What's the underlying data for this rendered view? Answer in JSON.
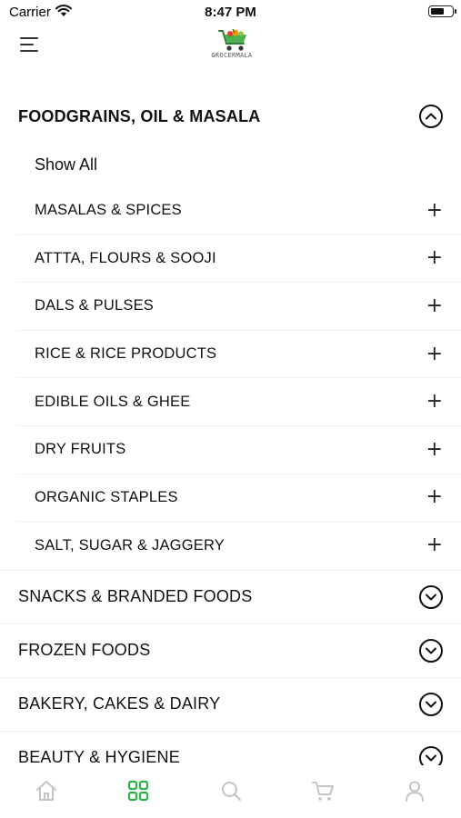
{
  "status_bar": {
    "carrier": "Carrier",
    "time": "8:47 PM"
  },
  "header": {
    "logo_text": "GROCERMALA"
  },
  "expanded_section": {
    "title": "FOODGRAINS, OIL & MASALA",
    "show_all": "Show All",
    "items": [
      {
        "label": "MASALAS & SPICES"
      },
      {
        "label": "ATTTA, FLOURS & SOOJI"
      },
      {
        "label": "DALS & PULSES"
      },
      {
        "label": "RICE & RICE PRODUCTS"
      },
      {
        "label": "EDIBLE OILS & GHEE"
      },
      {
        "label": "DRY FRUITS"
      },
      {
        "label": "ORGANIC STAPLES"
      },
      {
        "label": "SALT, SUGAR & JAGGERY"
      }
    ]
  },
  "categories": [
    {
      "label": "SNACKS & BRANDED FOODS"
    },
    {
      "label": "FROZEN FOODS"
    },
    {
      "label": "BAKERY, CAKES & DAIRY"
    },
    {
      "label": "BEAUTY & HYGIENE"
    }
  ],
  "bottom_nav": {
    "active": "categories",
    "active_color": "#2db34a",
    "inactive_color": "#c4c4c4",
    "items": [
      {
        "icon": "home-icon"
      },
      {
        "icon": "categories-icon"
      },
      {
        "icon": "search-icon"
      },
      {
        "icon": "cart-icon"
      },
      {
        "icon": "profile-icon"
      }
    ]
  }
}
